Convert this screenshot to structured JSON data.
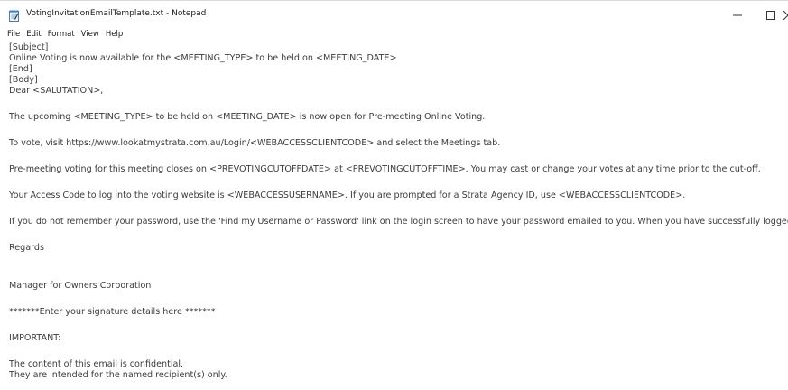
{
  "window": {
    "title": "VotingInvitationEmailTemplate.txt - Notepad"
  },
  "menu": [
    "File",
    "Edit",
    "Format",
    "View",
    "Help"
  ],
  "icons": {
    "app": "notepad-icon",
    "minimize": "minimize-icon",
    "maximize": "maximize-icon",
    "close": "close-icon"
  },
  "content": {
    "lines": [
      "[Subject]",
      "Online Voting is now available for the <MEETING_TYPE> to be held on <MEETING_DATE>",
      "[End]",
      "[Body]",
      "Dear <SALUTATION>,",
      "The upcoming <MEETING_TYPE> to be held on <MEETING_DATE> is now open for Pre-meeting Online Voting.",
      "To vote, visit https://www.lookatmystrata.com.au/Login/<WEBACCESSCLIENTCODE> and select the Meetings tab.",
      "Pre-meeting voting for this meeting closes on <PREVOTINGCUTOFFDATE> at <PREVOTINGCUTOFFTIME>. You may cast or change your votes at any time prior to the cut-off.",
      "Your Access Code to log into the voting website is <WEBACCESSUSERNAME>. If you are prompted for a Strata Agency ID, use <WEBACCESSCLIENTCODE>.",
      "If you do not remember your password, use the 'Find my Username or Password' link on the login screen to have your password emailed to you. When you have successfully logged i",
      "Regards",
      "Manager for Owners Corporation",
      "*******Enter your signature details here *******",
      "IMPORTANT:",
      "The content of this email is confidential.",
      "They are intended for the named recipient(s) only."
    ]
  }
}
